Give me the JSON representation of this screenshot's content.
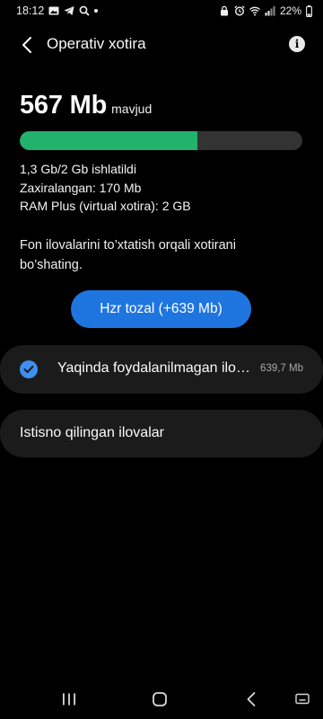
{
  "status_bar": {
    "time": "18:12",
    "battery": "22%",
    "left_icons": [
      "image-icon",
      "telegram-icon",
      "search-icon",
      "dot-icon"
    ],
    "right_icons": [
      "lock-icon",
      "alarm-icon",
      "wifi-icon",
      "signal-icon",
      "battery-icon"
    ]
  },
  "header": {
    "title": "Operativ xotira",
    "back_icon": "back-arrow-icon",
    "info_icon": "info-icon"
  },
  "memory": {
    "available_value": "567 Mb",
    "available_suffix": "mavjud",
    "used_fraction": 0.63,
    "bar_color": "#22b26b",
    "used_line": "1,3 Gb/2 Gb ishlatildi",
    "reserved_line": "Zaxiralangan: 170 Mb",
    "ram_plus_line": "RAM Plus (virtual xotira): 2 GB"
  },
  "description": "Fon ilovalarini to’xtatish orqali xotirani bo’shating.",
  "clean_button": {
    "label": "Hzr tozal (+639 Mb)",
    "color": "#1f75e0"
  },
  "apps_card": {
    "label": "Yaqinda foydalanilmagan ilo…",
    "size": "639,7 Mb",
    "checked": true,
    "icon": "check-circle-icon"
  },
  "excluded_card": {
    "label": "Istisno qilingan ilovalar"
  },
  "nav_bar": {
    "buttons": [
      "recent-apps-icon",
      "home-icon",
      "back-icon",
      "keyboard-icon"
    ]
  }
}
